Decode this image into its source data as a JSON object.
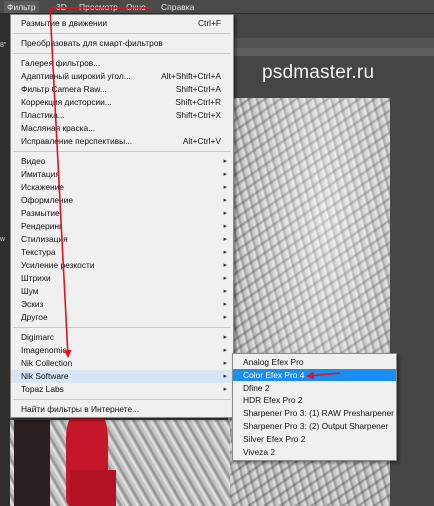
{
  "menubar": {
    "items": [
      "Фильтр",
      "3D",
      "Просмотр",
      "Окно",
      "Справка"
    ]
  },
  "left_panel_labels": [
    "8\"",
    "w"
  ],
  "brand": "psdmaster.ru",
  "filter_menu": {
    "groups": [
      [
        {
          "label": "Размытие в движении",
          "shortcut": "Ctrl+F"
        }
      ],
      [
        {
          "label": "Преобразовать для смарт-фильтров",
          "shortcut": ""
        }
      ],
      [
        {
          "label": "Галерея фильтров...",
          "shortcut": ""
        },
        {
          "label": "Адаптивный широкий угол...",
          "shortcut": "Alt+Shift+Ctrl+A"
        },
        {
          "label": "Фильтр Camera Raw...",
          "shortcut": "Shift+Ctrl+A"
        },
        {
          "label": "Коррекция дисторсии...",
          "shortcut": "Shift+Ctrl+R"
        },
        {
          "label": "Пластика...",
          "shortcut": "Shift+Ctrl+X"
        },
        {
          "label": "Масляная краска...",
          "shortcut": ""
        },
        {
          "label": "Исправление перспективы...",
          "shortcut": "Alt+Ctrl+V"
        }
      ],
      [
        {
          "label": "Видео",
          "submenu": true
        },
        {
          "label": "Имитация",
          "submenu": true
        },
        {
          "label": "Искажение",
          "submenu": true
        },
        {
          "label": "Оформление",
          "submenu": true
        },
        {
          "label": "Размытие",
          "submenu": true
        },
        {
          "label": "Рендеринг",
          "submenu": true
        },
        {
          "label": "Стилизация",
          "submenu": true
        },
        {
          "label": "Текстура",
          "submenu": true
        },
        {
          "label": "Усиление резкости",
          "submenu": true
        },
        {
          "label": "Штрихи",
          "submenu": true
        },
        {
          "label": "Шум",
          "submenu": true
        },
        {
          "label": "Эскиз",
          "submenu": true
        },
        {
          "label": "Другое",
          "submenu": true
        }
      ],
      [
        {
          "label": "Digimarc",
          "submenu": true
        },
        {
          "label": "Imagenomic",
          "submenu": true
        },
        {
          "label": "Nik Collection",
          "submenu": true
        },
        {
          "label": "Nik Software",
          "submenu": true,
          "highlighted": true
        },
        {
          "label": "Topaz Labs",
          "submenu": true
        }
      ],
      [
        {
          "label": "Найти фильтры в Интернете...",
          "shortcut": ""
        }
      ]
    ]
  },
  "nik_submenu": {
    "items": [
      {
        "label": "Analog Efex Pro"
      },
      {
        "label": "Color Efex Pro 4",
        "selected": true
      },
      {
        "label": "Dfine 2"
      },
      {
        "label": "HDR Efex Pro 2"
      },
      {
        "label": "Sharpener Pro 3: (1) RAW Presharpener"
      },
      {
        "label": "Sharpener Pro 3: (2) Output Sharpener"
      },
      {
        "label": "Silver Efex Pro 2"
      },
      {
        "label": "Viveza 2"
      }
    ]
  },
  "colors": {
    "annotation_red": "#e0141e",
    "selection_blue": "#1b8ef0",
    "menu_bg": "#f0f0f0"
  }
}
